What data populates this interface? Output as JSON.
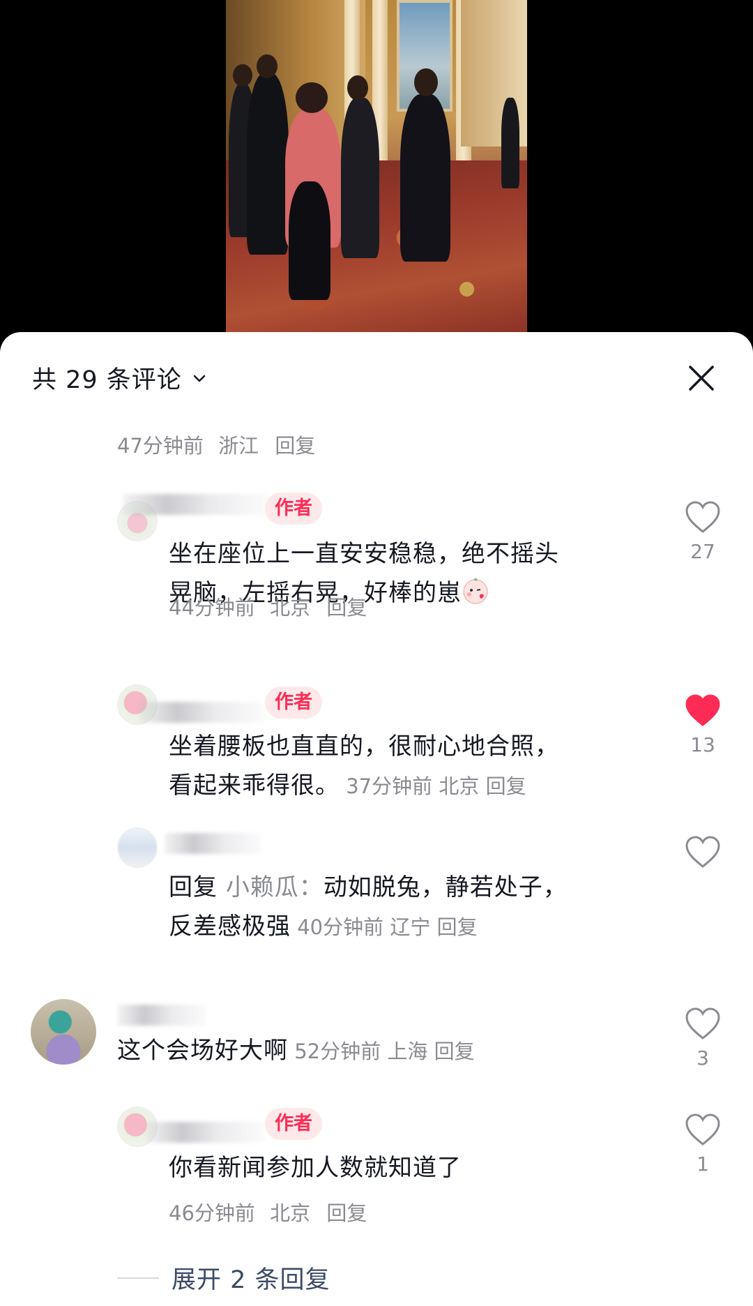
{
  "header": {
    "title": "共 29 条评论",
    "close_icon": "close-icon",
    "chevron_icon": "chevron-down-icon"
  },
  "top_reply_meta": {
    "time": "47分钟前",
    "location": "浙江",
    "reply": "回复"
  },
  "comments": [
    {
      "badge": "作者",
      "text_line1": "坐在座位上一直安安稳稳，绝不摇头",
      "text_line2": "晃脑，左摇右晃，好棒的崽",
      "time": "44分钟前",
      "location": "北京",
      "reply": "回复",
      "likes": "27",
      "liked": false
    },
    {
      "badge": "作者",
      "text_line1": "坐着腰板也直直的，很耐心地合照，",
      "text_line2": "看起来乖得很。",
      "time": "37分钟前",
      "location": "北京",
      "reply": "回复",
      "likes": "13",
      "liked": true
    },
    {
      "reply_prefix": "回复",
      "reply_to": "小赖瓜：",
      "text_line1": "动如脱兔，静若处子，",
      "text_line2": "反差感极强",
      "time": "40分钟前",
      "location": "辽宁",
      "reply": "回复",
      "likes": "",
      "liked": false
    },
    {
      "text_line1": "这个会场好大啊",
      "time": "52分钟前",
      "location": "上海",
      "reply": "回复",
      "likes": "3",
      "liked": false
    },
    {
      "badge": "作者",
      "text_line1": "你看新闻参加人数就知道了",
      "time": "46分钟前",
      "location": "北京",
      "reply": "回复",
      "likes": "1",
      "liked": false
    }
  ],
  "expand": {
    "label": "展开 2 条回复"
  },
  "colors": {
    "accent": "#fe2c55",
    "text_primary": "#161823",
    "text_secondary": "#8a8b91",
    "badge_bg": "#fde9ea",
    "link": "#3b4a66"
  }
}
